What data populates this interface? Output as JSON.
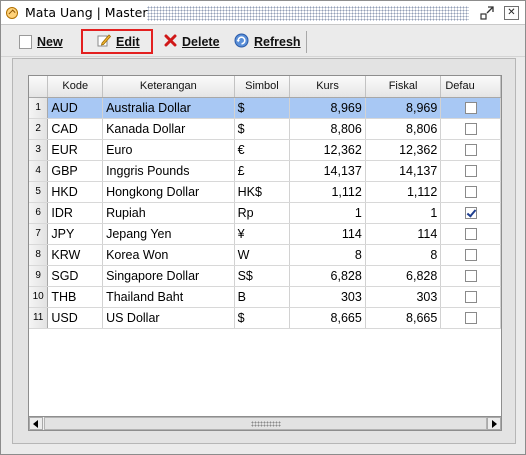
{
  "window": {
    "title": "Mata Uang | Master",
    "float_icon": "float-window-icon",
    "close_icon": "close-icon",
    "close_glyph": "✕"
  },
  "toolbar": {
    "new_label": "New",
    "edit_label": "Edit",
    "delete_label": "Delete",
    "refresh_label": "Refresh",
    "highlight_color": "#e32020"
  },
  "grid": {
    "columns": [
      "Kode",
      "Keterangan",
      "Simbol",
      "Kurs",
      "Fiskal",
      "Defau"
    ],
    "selected_row_color": "#a8c8f4",
    "rows": [
      {
        "no": "1",
        "kode": "AUD",
        "keterangan": "Australia Dollar",
        "simbol": "$",
        "kurs": "8,969",
        "fiskal": "8,969",
        "default": false
      },
      {
        "no": "2",
        "kode": "CAD",
        "keterangan": "Kanada Dollar",
        "simbol": "$",
        "kurs": "8,806",
        "fiskal": "8,806",
        "default": false
      },
      {
        "no": "3",
        "kode": "EUR",
        "keterangan": "Euro",
        "simbol": "€",
        "kurs": "12,362",
        "fiskal": "12,362",
        "default": false
      },
      {
        "no": "4",
        "kode": "GBP",
        "keterangan": "Inggris Pounds",
        "simbol": "£",
        "kurs": "14,137",
        "fiskal": "14,137",
        "default": false
      },
      {
        "no": "5",
        "kode": "HKD",
        "keterangan": "Hongkong Dollar",
        "simbol": "HK$",
        "kurs": "1,112",
        "fiskal": "1,112",
        "default": false
      },
      {
        "no": "6",
        "kode": "IDR",
        "keterangan": "Rupiah",
        "simbol": "Rp",
        "kurs": "1",
        "fiskal": "1",
        "default": true
      },
      {
        "no": "7",
        "kode": "JPY",
        "keterangan": "Jepang Yen",
        "simbol": "¥",
        "kurs": "114",
        "fiskal": "114",
        "default": false
      },
      {
        "no": "8",
        "kode": "KRW",
        "keterangan": "Korea Won",
        "simbol": "W",
        "kurs": "8",
        "fiskal": "8",
        "default": false
      },
      {
        "no": "9",
        "kode": "SGD",
        "keterangan": "Singapore Dollar",
        "simbol": "S$",
        "kurs": "6,828",
        "fiskal": "6,828",
        "default": false
      },
      {
        "no": "10",
        "kode": "THB",
        "keterangan": "Thailand Baht",
        "simbol": "B",
        "kurs": "303",
        "fiskal": "303",
        "default": false
      },
      {
        "no": "11",
        "kode": "USD",
        "keterangan": "US Dollar",
        "simbol": "$",
        "kurs": "8,665",
        "fiskal": "8,665",
        "default": false
      }
    ]
  }
}
